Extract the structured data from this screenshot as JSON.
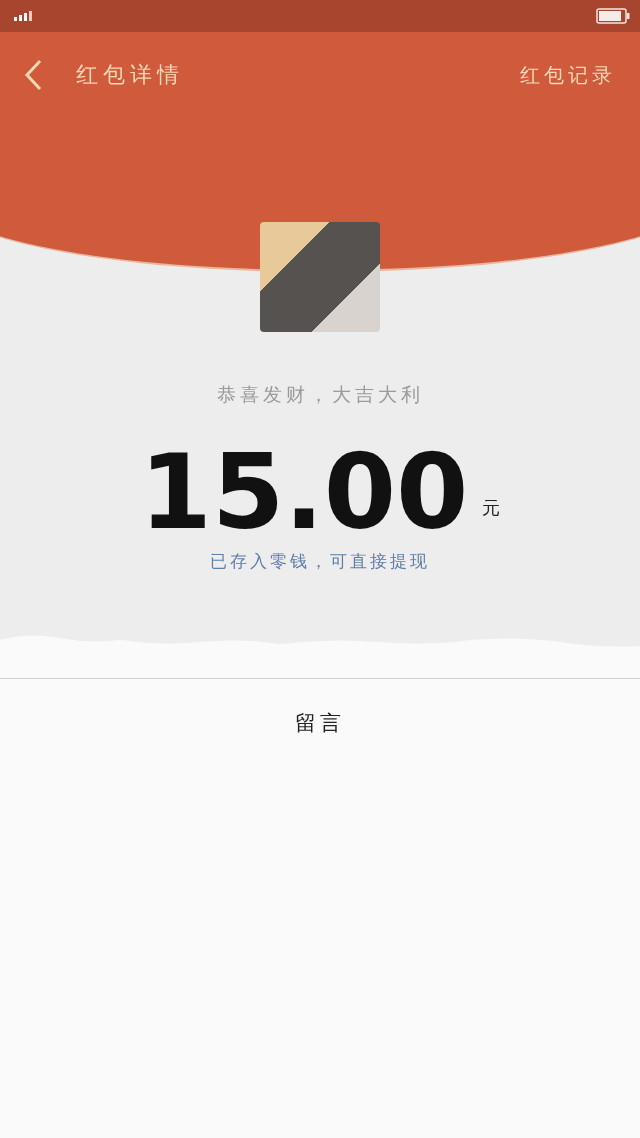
{
  "nav": {
    "title": "红包详情",
    "action": "红包记录"
  },
  "packet": {
    "greeting": "恭喜发财，大吉大利",
    "amount": "15.00",
    "unit": "元",
    "note": "已存入零钱，可直接提现"
  },
  "messages": {
    "title": "留言"
  }
}
